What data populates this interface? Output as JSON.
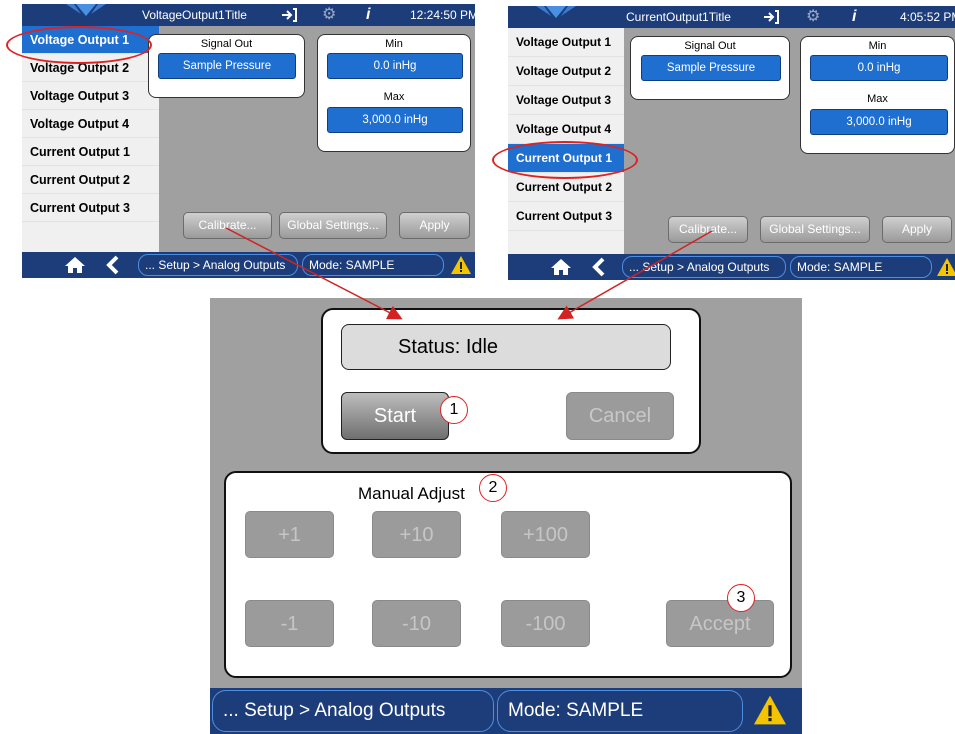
{
  "colors": {
    "accent": "#1f6fd1",
    "header": "#1d3d7a",
    "annotation": "#d22222",
    "warning": "#f5c400"
  },
  "screen_left": {
    "title": "VoltageOutput1Title",
    "time": "12:24:50 PM",
    "icons": [
      "logo-icon",
      "exit-icon",
      "gear-icon",
      "info-icon"
    ],
    "sidebar": [
      "Voltage Output 1",
      "Voltage Output 2",
      "Voltage Output 3",
      "Voltage Output 4",
      "Current Output 1",
      "Current Output 2",
      "Current Output 3"
    ],
    "active_index": 0,
    "signal_out": {
      "label": "Signal Out",
      "value": "Sample Pressure"
    },
    "min": {
      "label": "Min",
      "value": "0.0 inHg"
    },
    "max": {
      "label": "Max",
      "value": "3,000.0 inHg"
    },
    "buttons": {
      "calibrate": "Calibrate...",
      "global": "Global Settings...",
      "apply": "Apply"
    },
    "breadcrumb": "... Setup > Analog Outputs",
    "mode": "Mode: SAMPLE"
  },
  "screen_right": {
    "title": "CurrentOutput1Title",
    "time": "4:05:52 PM",
    "sidebar": [
      "Voltage Output 1",
      "Voltage Output 2",
      "Voltage Output 3",
      "Voltage Output 4",
      "Current Output 1",
      "Current Output 2",
      "Current Output 3"
    ],
    "active_index": 4,
    "signal_out": {
      "label": "Signal Out",
      "value": "Sample Pressure"
    },
    "min": {
      "label": "Min",
      "value": "0.0 inHg"
    },
    "max": {
      "label": "Max",
      "value": "3,000.0 inHg"
    },
    "buttons": {
      "calibrate": "Calibrate...",
      "global": "Global Settings...",
      "apply": "Apply"
    },
    "breadcrumb": "... Setup > Analog Outputs",
    "mode": "Mode: SAMPLE"
  },
  "calibrate_screen": {
    "status": "Status:  Idle",
    "start": "Start",
    "cancel": "Cancel",
    "manual_adjust": "Manual Adjust",
    "plus": [
      "+1",
      "+10",
      "+100"
    ],
    "minus": [
      "-1",
      "-10",
      "-100"
    ],
    "accept": "Accept",
    "breadcrumb": "... Setup > Analog Outputs",
    "mode": "Mode: SAMPLE"
  },
  "callouts": [
    "1",
    "2",
    "3"
  ]
}
